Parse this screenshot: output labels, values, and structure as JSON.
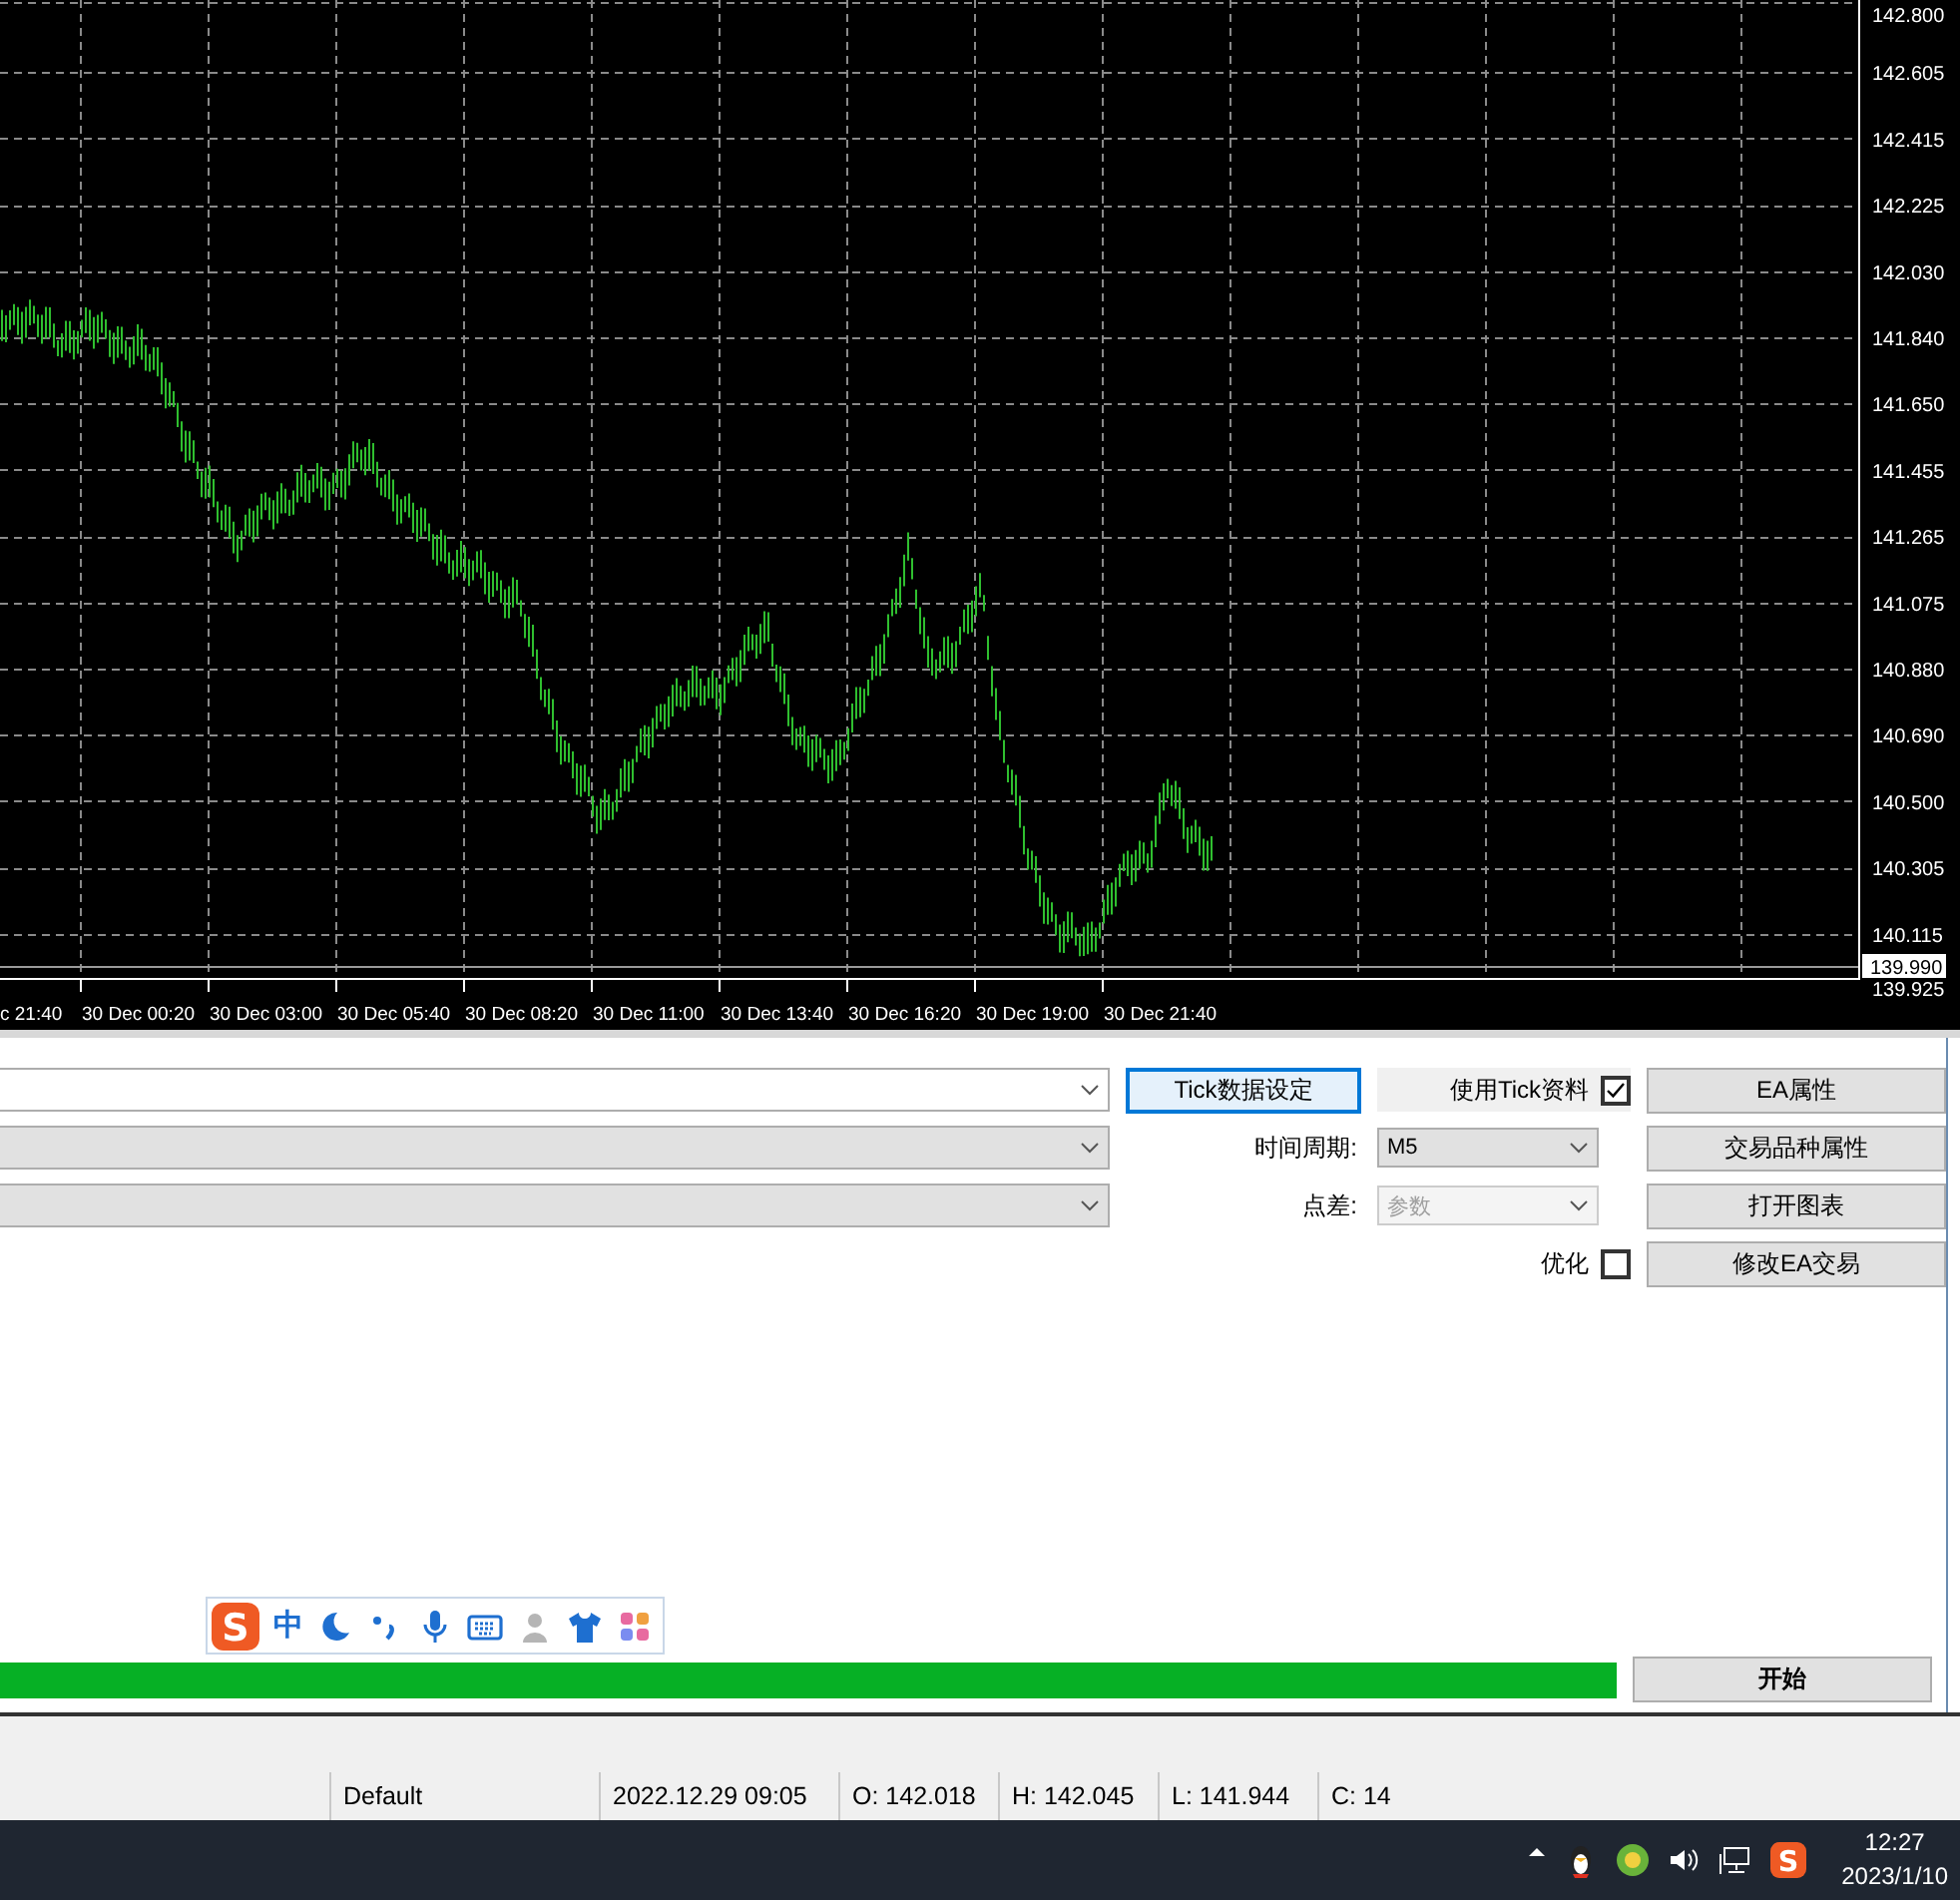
{
  "chart": {
    "price_axis_labels": [
      "142.800",
      "142.605",
      "142.415",
      "142.225",
      "142.030",
      "141.840",
      "141.650",
      "141.455",
      "141.265",
      "141.075",
      "140.880",
      "140.690",
      "140.500",
      "140.305",
      "140.115"
    ],
    "current_price": "139.990",
    "bottom_price": "139.925",
    "time_axis_labels": [
      "c 21:40",
      "30 Dec 00:20",
      "30 Dec 03:00",
      "30 Dec 05:40",
      "30 Dec 08:20",
      "30 Dec 11:00",
      "30 Dec 13:40",
      "30 Dec 16:20",
      "30 Dec 19:00",
      "30 Dec 21:40"
    ]
  },
  "tester": {
    "left_fields": [
      {
        "kind": "edit"
      },
      {
        "kind": "combo"
      },
      {
        "kind": "combo"
      }
    ],
    "tick_settings_button": {
      "label": "Tick数据设定",
      "focused": true
    },
    "use_tick": {
      "label": "使用Tick资料",
      "checked": true
    },
    "period": {
      "label": "时间周期:",
      "value": "M5"
    },
    "spread": {
      "label": "点差:",
      "value": "参数",
      "disabled": true
    },
    "optimize": {
      "label": "优化",
      "checked": false
    },
    "side_buttons": [
      "EA属性",
      "交易品种属性",
      "打开图表",
      "修改EA交易"
    ],
    "progress": {
      "level": 1
    },
    "start_button": "开始"
  },
  "ime_toolbar": {
    "logo": "S",
    "mode": "中"
  },
  "status_bar": [
    "Default",
    "2022.12.29 09:05",
    "O: 142.018",
    "H: 142.045",
    "L: 141.944",
    "C: 14"
  ],
  "taskbar": {
    "tray_logo": "S",
    "time": "12:27",
    "date": "2023/1/10"
  }
}
